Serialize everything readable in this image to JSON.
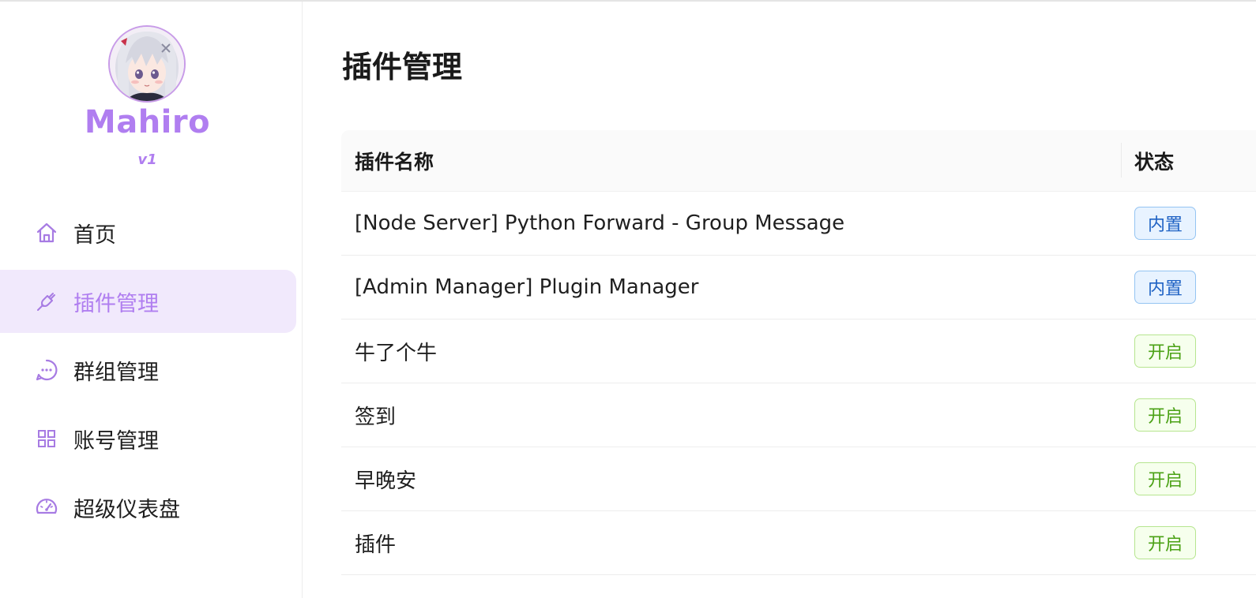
{
  "brand": {
    "name": "Mahiro",
    "version": "v1",
    "accent_color": "#b07ef0"
  },
  "sidebar": {
    "items": [
      {
        "label": "首页",
        "icon": "home-icon",
        "active": false
      },
      {
        "label": "插件管理",
        "icon": "plug-icon",
        "active": true
      },
      {
        "label": "群组管理",
        "icon": "chat-bubble-icon",
        "active": false
      },
      {
        "label": "账号管理",
        "icon": "grid-icon",
        "active": false
      },
      {
        "label": "超级仪表盘",
        "icon": "dashboard-gauge-icon",
        "active": false
      }
    ]
  },
  "main": {
    "title": "插件管理",
    "table": {
      "columns": [
        "插件名称",
        "状态"
      ],
      "rows": [
        {
          "name": "[Node Server] Python Forward - Group Message",
          "status": "内置",
          "status_type": "builtin"
        },
        {
          "name": "[Admin Manager] Plugin Manager",
          "status": "内置",
          "status_type": "builtin"
        },
        {
          "name": "牛了个牛",
          "status": "开启",
          "status_type": "enabled"
        },
        {
          "name": "签到",
          "status": "开启",
          "status_type": "enabled"
        },
        {
          "name": "早晚安",
          "status": "开启",
          "status_type": "enabled"
        },
        {
          "name": "插件",
          "status": "开启",
          "status_type": "enabled"
        }
      ]
    }
  },
  "colors": {
    "builtin_badge": "#1f62c4",
    "enabled_badge": "#4ba115"
  }
}
